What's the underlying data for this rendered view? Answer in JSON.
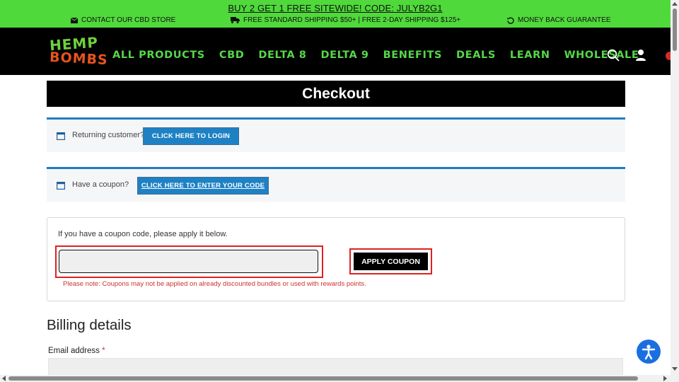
{
  "promo": {
    "headline": "BUY 2 GET 1 FREE SITEWIDE! CODE: JULYB2G1",
    "contact": "CONTACT OUR CBD STORE",
    "shipping": "FREE STANDARD SHIPPING $50+ | FREE 2-DAY SHIPPING $125+",
    "guarantee": "MONEY BACK GUARANTEE",
    "background_color": "#4fd93b"
  },
  "header": {
    "logo_line1": "HEMP",
    "logo_line2": "BOMBS",
    "nav": [
      "ALL PRODUCTS",
      "CBD",
      "DELTA 8",
      "DELTA 9",
      "BENEFITS",
      "DEALS",
      "LEARN",
      "WHOLESALE"
    ],
    "icons": [
      "search-icon",
      "user-icon",
      "cart-icon"
    ],
    "nav_color": "#56d64a"
  },
  "checkout": {
    "title": "Checkout",
    "login_notice": "Returning customer?",
    "login_button": "CLICK HERE TO LOGIN",
    "coupon_notice": "Have a coupon?",
    "coupon_button": "CLICK HERE TO ENTER YOUR CODE",
    "coupon_hint": "If you have a coupon code, please apply it below.",
    "coupon_input_value": "",
    "apply_button": "APPLY COUPON",
    "coupon_note": "Please note: Coupons may not be applied on already discounted bundles or used with rewards points.",
    "accent_color": "#1e81c4"
  },
  "billing": {
    "title": "Billing details",
    "email_label": "Email address",
    "required_mark": "*",
    "email_value": ""
  }
}
